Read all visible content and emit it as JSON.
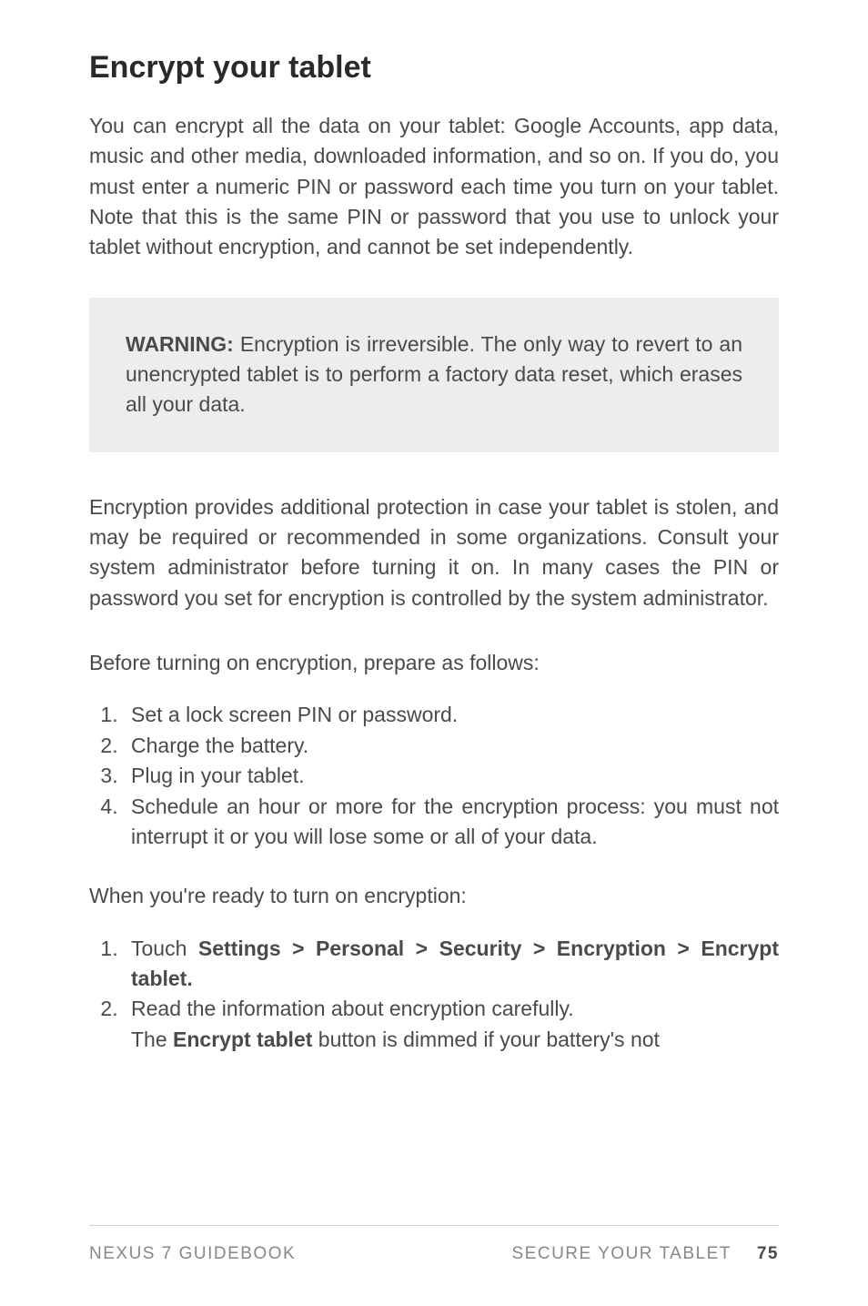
{
  "title": "Encrypt your tablet",
  "intro": "You can encrypt all the data on your tablet: Google Accounts, app data, music and other media, downloaded information, and so on. If you do, you must enter a numeric PIN or password each time you turn on your tablet. Note that this is the same PIN or pass­word that you use to unlock your tablet without encryption, and cannot be set independently.",
  "warning": {
    "label": "WARNING:",
    "text": " Encryption is irreversible. The only way to revert to an unencrypted tablet is to perform a factory data reset, which erases all your data."
  },
  "para2": "Encryption provides additional protection in case your tablet is stolen, and may be required or recommended in some organiza­tions. Consult your system administrator before turning it on. In many cases the PIN or password you set for encryption is con­trolled by the system administrator.",
  "para_prepare": "Before turning on encryption, prepare as follows:",
  "prepare_list": {
    "item1": "Set a lock screen PIN or password.",
    "item2": "Charge the battery.",
    "item3": "Plug in your tablet.",
    "item4": "Schedule an hour or more for the encryption process: you must not interrupt it or you will lose some or all of your data."
  },
  "para_ready": "When you're ready to turn on encryption:",
  "ready_list": {
    "item1_prefix": "Touch ",
    "item1_bold": "Settings > Personal > Security > Encryption > Encrypt tablet.",
    "item2_line1": "Read the information about encryption carefully.",
    "item2_line2_prefix": "The ",
    "item2_line2_bold": "Encrypt tablet",
    "item2_line2_suffix": " button is dimmed if your battery's not"
  },
  "footer": {
    "left": "NEXUS 7 GUIDEBOOK",
    "right": "SECURE YOUR TABLET",
    "page": "75"
  }
}
